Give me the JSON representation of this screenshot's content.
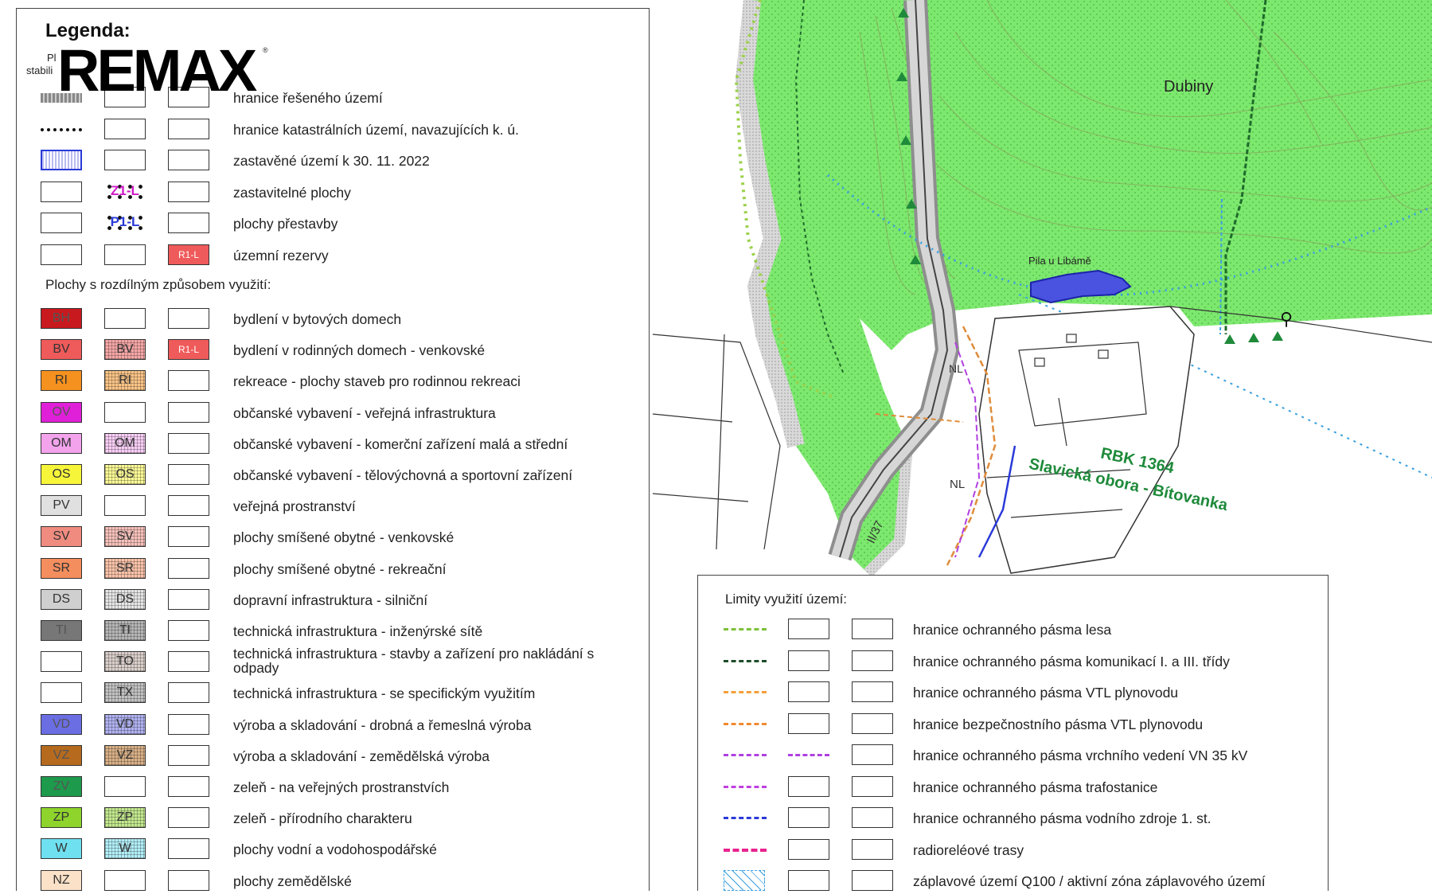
{
  "watermark": {
    "brand": "REMAX",
    "mark": "®"
  },
  "legend": {
    "title": "Legenda:",
    "col_header_1": "Pl",
    "col_header_2": "stabili",
    "rows": [
      {
        "name": "solution-boundary",
        "label": "hranice řešeného území",
        "sym1": "",
        "sym2": "",
        "sym3": ""
      },
      {
        "name": "cadastral-boundary",
        "label": "hranice katastrálních území, navazujících k. ú.",
        "sym1": "",
        "sym2": "",
        "sym3": ""
      },
      {
        "name": "built-up-area",
        "label": "zastavěné území k 30. 11. 2022",
        "sym1": "",
        "sym2": "",
        "sym3": ""
      },
      {
        "name": "buildable-areas",
        "label": "zastavitelné plochy",
        "sym1": "",
        "sym2": "Z1-L",
        "sym3": ""
      },
      {
        "name": "redevelopment-areas",
        "label": "plochy přestavby",
        "sym1": "",
        "sym2": "P1-L",
        "sym3": ""
      },
      {
        "name": "territorial-reserves",
        "label": "územní rezervy",
        "sym1": "",
        "sym2": "",
        "sym3": "R1-L"
      }
    ],
    "section_title": "Plochy s rozdílným způsobem využití:",
    "areas": [
      {
        "name": "bh",
        "label": "bydlení v bytových domech",
        "code1": "BH",
        "code2": "",
        "code3": "",
        "color": "#c8191e"
      },
      {
        "name": "bv",
        "label": "bydlení v rodinných domech - venkovské",
        "code1": "BV",
        "code2": "BV",
        "code3": "R1-L",
        "color": "#ef5a5a"
      },
      {
        "name": "ri",
        "label": "rekreace - plochy staveb pro rodinnou rekreaci",
        "code1": "RI",
        "code2": "RI",
        "code3": "",
        "color": "#f5911e"
      },
      {
        "name": "ov",
        "label": "občanské vybavení - veřejná infrastruktura",
        "code1": "OV",
        "code2": "",
        "code3": "",
        "color": "#e020d8"
      },
      {
        "name": "om",
        "label": "občanské vybavení - komerční zařízení malá a střední",
        "code1": "OM",
        "code2": "OM",
        "code3": "",
        "color": "#f2a3ec"
      },
      {
        "name": "os",
        "label": "občanské vybavení - tělovýchovná a sportovní zařízení",
        "code1": "OS",
        "code2": "OS",
        "code3": "",
        "color": "#f7f53a"
      },
      {
        "name": "pv",
        "label": "veřejná prostranství",
        "code1": "PV",
        "code2": "",
        "code3": "",
        "color": "#e0e0e0"
      },
      {
        "name": "sv",
        "label": "plochy smíšené obytné - venkovské",
        "code1": "SV",
        "code2": "SV",
        "code3": "",
        "color": "#f08b7f"
      },
      {
        "name": "sr",
        "label": "plochy smíšené obytné - rekreační",
        "code1": "SR",
        "code2": "SR",
        "code3": "",
        "color": "#f58e5e"
      },
      {
        "name": "ds",
        "label": "dopravní infrastruktura - silniční",
        "code1": "DS",
        "code2": "DS",
        "code3": "",
        "color": "#cfcfcf"
      },
      {
        "name": "ti",
        "label": "technická infrastruktura - inženýrské sítě",
        "code1": "TI",
        "code2": "TI",
        "code3": "",
        "color": "#777777"
      },
      {
        "name": "to",
        "label": "technická infrastruktura - stavby a zařízení pro nakládání s odpady",
        "code1": "",
        "code2": "TO",
        "code3": "",
        "color": "#b9a59b"
      },
      {
        "name": "tx",
        "label": "technická infrastruktura - se specifickým využitím",
        "code1": "",
        "code2": "TX",
        "code3": "",
        "color": "#8c8c8c"
      },
      {
        "name": "vd",
        "label": "výroba a skladování - drobná a řemeslná výroba",
        "code1": "VD",
        "code2": "VD",
        "code3": "",
        "color": "#6b6ee3"
      },
      {
        "name": "vz",
        "label": "výroba a skladování - zemědělská výroba",
        "code1": "VZ",
        "code2": "VZ",
        "code3": "",
        "color": "#b56a1e"
      },
      {
        "name": "zv",
        "label": "zeleň - na veřejných prostranstvích",
        "code1": "ZV",
        "code2": "",
        "code3": "",
        "color": "#1d9a4b"
      },
      {
        "name": "zp",
        "label": "zeleň - přírodního charakteru",
        "code1": "ZP",
        "code2": "ZP",
        "code3": "",
        "color": "#8ed42d"
      },
      {
        "name": "w",
        "label": "plochy vodní a vodohospodářské",
        "code1": "W",
        "code2": "W",
        "code3": "",
        "color": "#6fe0f0"
      },
      {
        "name": "nz",
        "label": "plochy zemědělské",
        "code1": "NZ",
        "code2": "",
        "code3": "",
        "color": "#fbe1c8"
      }
    ]
  },
  "limits": {
    "title": "Limity využití území:",
    "rows": [
      {
        "name": "forest-zone",
        "label": "hranice ochranného pásma lesa",
        "color": "#7cc13a"
      },
      {
        "name": "road-zone",
        "label": "hranice ochranného pásma komunikací I. a III. třídy",
        "color": "#1e4d2b"
      },
      {
        "name": "gas-zone",
        "label": "hranice ochranného pásma VTL plynovodu",
        "color": "#f4a03a"
      },
      {
        "name": "gas-safety",
        "label": "hranice bezpečnostního pásma VTL plynovodu",
        "color": "#f08a30"
      },
      {
        "name": "vn-zone",
        "label": "hranice ochranného pásma vrchního vedení VN 35 kV",
        "color": "#b040e0"
      },
      {
        "name": "substation-zone",
        "label": "hranice ochranného pásma trafostanice",
        "color": "#c040e0"
      },
      {
        "name": "water-source",
        "label": "hranice ochranného pásma vodního zdroje 1. st.",
        "color": "#2a3ad8"
      },
      {
        "name": "radio",
        "label": "radioreléové trasy",
        "color": "#e8238f"
      },
      {
        "name": "flood",
        "label": "záplavové území Q100 / aktivní zóna záplavového území",
        "color": "#3aa0e0"
      }
    ]
  },
  "map": {
    "label_dubiny": "Dubiny",
    "label_pila": "Pila u Libámě",
    "label_rbk": "RBK 1364",
    "label_obora": "Slavická obora - Bítovanka",
    "label_nl1": "NL",
    "label_nl2": "NL",
    "label_road": "II/37",
    "colors": {
      "forest": "#7de86e",
      "forest_dark": "#5fcf52",
      "road": "#9a9a9a",
      "water": "#3aa0e0"
    }
  }
}
